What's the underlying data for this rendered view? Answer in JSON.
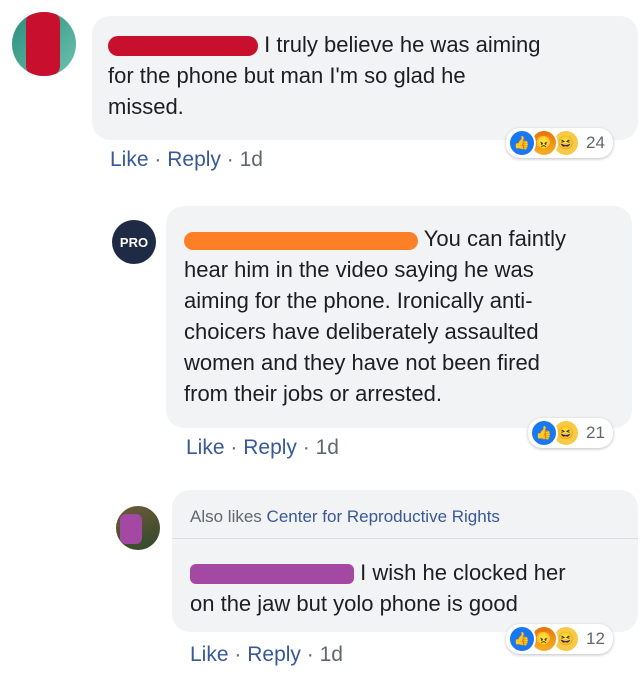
{
  "comments": [
    {
      "text": "I truly believe he was aiming for the phone but man I'm so glad he missed.",
      "line1": "I truly believe he was aiming",
      "line2": "for the phone but man I'm so glad he",
      "line3": "missed.",
      "actions": {
        "like": "Like",
        "reply": "Reply",
        "time": "1d"
      },
      "reactions": {
        "icons": [
          "like-icon",
          "angry-icon",
          "haha-icon"
        ],
        "count": "24"
      },
      "colors": {
        "redaction": "#c8102e"
      }
    },
    {
      "line1": "You can faintly",
      "line2": "hear him in the video saying he was",
      "line3": "aiming for the phone. Ironically anti-",
      "line4": "choicers have deliberately assaulted",
      "line5": "women and they have not been fired",
      "line6": "from their jobs or arrested.",
      "actions": {
        "like": "Like",
        "reply": "Reply",
        "time": "1d"
      },
      "reactions": {
        "icons": [
          "like-icon",
          "haha-icon"
        ],
        "count": "21"
      },
      "avatar_text": "PRO",
      "colors": {
        "redaction": "#ff7f27"
      }
    },
    {
      "also_likes_prefix": "Also likes",
      "also_likes_page": "Center for Reproductive Rights",
      "line1": "I wish he clocked her",
      "line2": "on the jaw but yolo phone is good",
      "actions": {
        "like": "Like",
        "reply": "Reply",
        "time": "1d"
      },
      "reactions": {
        "icons": [
          "like-icon",
          "angry-icon",
          "haha-icon"
        ],
        "count": "12"
      },
      "colors": {
        "redaction": "#a349a4"
      }
    }
  ],
  "separator": "·"
}
